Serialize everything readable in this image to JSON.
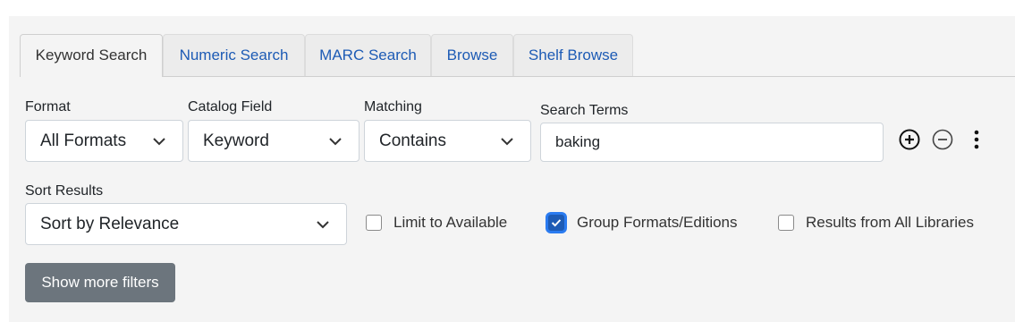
{
  "tabs": [
    {
      "label": "Keyword Search",
      "active": true
    },
    {
      "label": "Numeric Search",
      "active": false
    },
    {
      "label": "MARC Search",
      "active": false
    },
    {
      "label": "Browse",
      "active": false
    },
    {
      "label": "Shelf Browse",
      "active": false
    }
  ],
  "row1": {
    "format": {
      "label": "Format",
      "value": "All Formats"
    },
    "catalog_field": {
      "label": "Catalog Field",
      "value": "Keyword"
    },
    "matching": {
      "label": "Matching",
      "value": "Contains"
    },
    "search_terms": {
      "label": "Search Terms",
      "value": "baking"
    },
    "actions": {
      "add_icon": "plus-circle-icon",
      "remove_icon": "minus-circle-icon",
      "menu_icon": "vertical-ellipsis-icon"
    }
  },
  "row2": {
    "sort": {
      "label": "Sort Results",
      "value": "Sort by Relevance"
    },
    "limit_available": {
      "label": "Limit to Available",
      "checked": false
    },
    "group_formats": {
      "label": "Group Formats/Editions",
      "checked": true
    },
    "all_libraries": {
      "label": "Results from All Libraries",
      "checked": false
    }
  },
  "show_more_filters": "Show more filters",
  "colors": {
    "panel_bg": "#f4f4f4",
    "link": "#1d5bb5",
    "button_secondary": "#6c757d",
    "checkbox_checked": "#1d5bb5"
  }
}
